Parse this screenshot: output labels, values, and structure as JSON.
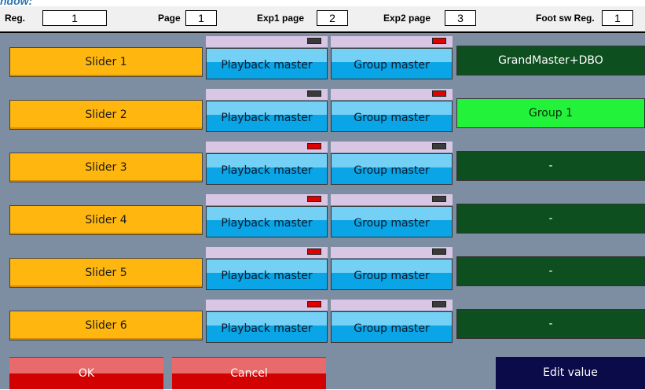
{
  "caption": "ndow:",
  "topbar": {
    "reg_label": "Reg.",
    "reg_value": "1",
    "page_label": "Page",
    "page_value": "1",
    "exp1_label": "Exp1 page",
    "exp1_value": "2",
    "exp2_label": "Exp2 page",
    "exp2_value": "3",
    "foot_label": "Foot sw Reg.",
    "foot_value": "1"
  },
  "rows": [
    {
      "slider": "Slider 1",
      "playback": "Playback master",
      "group": "Group master",
      "playback_led": "off",
      "group_led": "on",
      "right": "GrandMaster+DBO",
      "right_active": false
    },
    {
      "slider": "Slider 2",
      "playback": "Playback master",
      "group": "Group master",
      "playback_led": "off",
      "group_led": "on",
      "right": "Group 1",
      "right_active": true
    },
    {
      "slider": "Slider 3",
      "playback": "Playback master",
      "group": "Group master",
      "playback_led": "on",
      "group_led": "off",
      "right": "-",
      "right_active": false
    },
    {
      "slider": "Slider 4",
      "playback": "Playback master",
      "group": "Group master",
      "playback_led": "on",
      "group_led": "off",
      "right": "-",
      "right_active": false
    },
    {
      "slider": "Slider 5",
      "playback": "Playback master",
      "group": "Group master",
      "playback_led": "on",
      "group_led": "off",
      "right": "-",
      "right_active": false
    },
    {
      "slider": "Slider 6",
      "playback": "Playback master",
      "group": "Group master",
      "playback_led": "on",
      "group_led": "off",
      "right": "-",
      "right_active": false
    }
  ],
  "colors": {
    "led_on": "#e10000",
    "led_off": "#3a3a3a",
    "right_active_bg": "#22f23a",
    "right_active_text": "#0a2a0a",
    "right_inactive_bg": "#0d4f1f",
    "right_inactive_text": "#ffffff",
    "ok_bg": "#e86a6a",
    "ok_bottom": "#d20000",
    "edit_bg": "#0b0b4a"
  },
  "buttons": {
    "ok": "OK",
    "cancel": "Cancel",
    "edit_value": "Edit value"
  }
}
